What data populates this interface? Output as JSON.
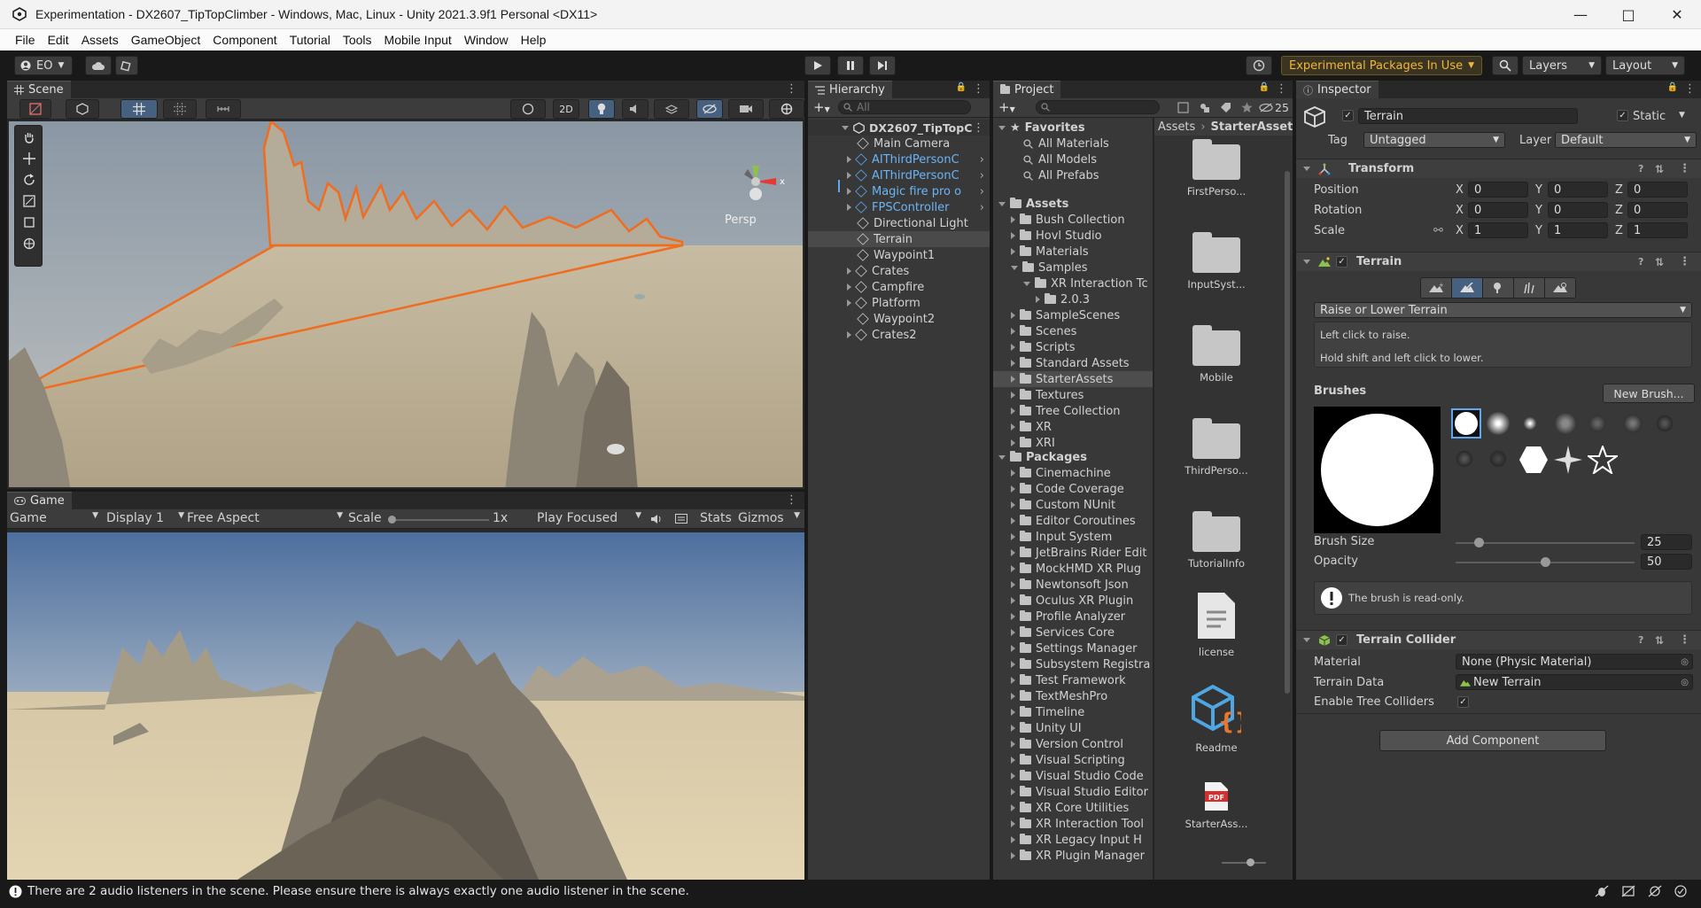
{
  "window": {
    "title": "Experimentation - DX2607_TipTopClimber - Windows, Mac, Linux - Unity 2021.3.9f1 Personal <DX11>"
  },
  "menu": [
    "File",
    "Edit",
    "Assets",
    "GameObject",
    "Component",
    "Tutorial",
    "Tools",
    "Mobile Input",
    "Window",
    "Help"
  ],
  "toolbar": {
    "account": "EO",
    "experimental": "Experimental Packages In Use",
    "layers": "Layers",
    "layout": "Layout"
  },
  "scene": {
    "tab": "Scene",
    "mode_2d": "2D",
    "persp": "Persp"
  },
  "game": {
    "tab": "Game",
    "view": "Game",
    "display": "Display 1",
    "aspect": "Free Aspect",
    "scale_label": "Scale",
    "scale_value": "1x",
    "play_mode": "Play Focused",
    "stats": "Stats",
    "gizmos": "Gizmos"
  },
  "hierarchy": {
    "tab": "Hierarchy",
    "search_placeholder": "All",
    "scene": "DX2607_TipTopC",
    "items": [
      {
        "label": "Main Camera",
        "prefab": false,
        "arrow": false
      },
      {
        "label": "AIThirdPersonC",
        "prefab": true,
        "arrow": true
      },
      {
        "label": "AIThirdPersonC",
        "prefab": true,
        "arrow": true
      },
      {
        "label": "Magic fire pro o",
        "prefab": true,
        "arrow": true
      },
      {
        "label": "FPSController",
        "prefab": true,
        "arrow": true
      },
      {
        "label": "Directional Light",
        "prefab": false,
        "arrow": false
      },
      {
        "label": "Terrain",
        "prefab": false,
        "arrow": false,
        "selected": true
      },
      {
        "label": "Waypoint1",
        "prefab": false,
        "arrow": false
      },
      {
        "label": "Crates",
        "prefab": false,
        "arrow": true
      },
      {
        "label": "Campfire",
        "prefab": false,
        "arrow": true
      },
      {
        "label": "Platform",
        "prefab": false,
        "arrow": true
      },
      {
        "label": "Waypoint2",
        "prefab": false,
        "arrow": false
      },
      {
        "label": "Crates2",
        "prefab": false,
        "arrow": true
      }
    ]
  },
  "project": {
    "tab": "Project",
    "hidden_count": "25",
    "favorites": {
      "label": "Favorites",
      "items": [
        "All Materials",
        "All Models",
        "All Prefabs"
      ]
    },
    "assets": {
      "label": "Assets",
      "items": [
        "Bush Collection",
        "Hovl Studio",
        "Materials",
        "Samples",
        "XR Interaction Tc",
        "2.0.3",
        "SampleScenes",
        "Scenes",
        "Scripts",
        "Standard Assets",
        "StarterAssets",
        "Textures",
        "Tree Collection",
        "XR",
        "XRI"
      ]
    },
    "packages": {
      "label": "Packages",
      "items": [
        "Cinemachine",
        "Code Coverage",
        "Custom NUnit",
        "Editor Coroutines",
        "Input System",
        "JetBrains Rider Edit",
        "MockHMD XR Plug",
        "Newtonsoft Json",
        "Oculus XR Plugin",
        "Profile Analyzer",
        "Services Core",
        "Settings Manager",
        "Subsystem Registra",
        "Test Framework",
        "TextMeshPro",
        "Timeline",
        "Unity UI",
        "Version Control",
        "Visual Scripting",
        "Visual Studio Code",
        "Visual Studio Editor",
        "XR Core Utilities",
        "XR Interaction Tool",
        "XR Legacy Input H",
        "XR Plugin Manager"
      ]
    },
    "breadcrumb": [
      "Assets",
      "StarterAsset"
    ],
    "grid": [
      "FirstPerso...",
      "InputSyst...",
      "Mobile",
      "ThirdPerso...",
      "TutorialInfo",
      "license",
      "Readme",
      "StarterAss..."
    ]
  },
  "inspector": {
    "tab": "Inspector",
    "name": "Terrain",
    "static": "Static",
    "tag_label": "Tag",
    "tag": "Untagged",
    "layer_label": "Layer",
    "layer": "Default",
    "transform": {
      "title": "Transform",
      "position": {
        "label": "Position",
        "x": "0",
        "y": "0",
        "z": "0"
      },
      "rotation": {
        "label": "Rotation",
        "x": "0",
        "y": "0",
        "z": "0"
      },
      "scale": {
        "label": "Scale",
        "x": "1",
        "y": "1",
        "z": "1"
      }
    },
    "terrain": {
      "title": "Terrain",
      "tool": "Raise or Lower Terrain",
      "help1": "Left click to raise.",
      "help2": "Hold shift and left click to lower.",
      "brushes": "Brushes",
      "new_brush": "New Brush...",
      "brush_size_label": "Brush Size",
      "brush_size": "25",
      "opacity_label": "Opacity",
      "opacity": "50",
      "readonly": "The brush is read-only."
    },
    "collider": {
      "title": "Terrain Collider",
      "material_label": "Material",
      "material": "None (Physic Material)",
      "data_label": "Terrain Data",
      "data": "New Terrain",
      "trees_label": "Enable Tree Colliders"
    },
    "add_component": "Add Component"
  },
  "status": {
    "message": "There are 2 audio listeners in the scene. Please ensure there is always exactly one audio listener in the scene."
  },
  "colors": {
    "selection": "#f06c1e",
    "prefab": "#6bb4f4",
    "accent": "#e8a530"
  }
}
